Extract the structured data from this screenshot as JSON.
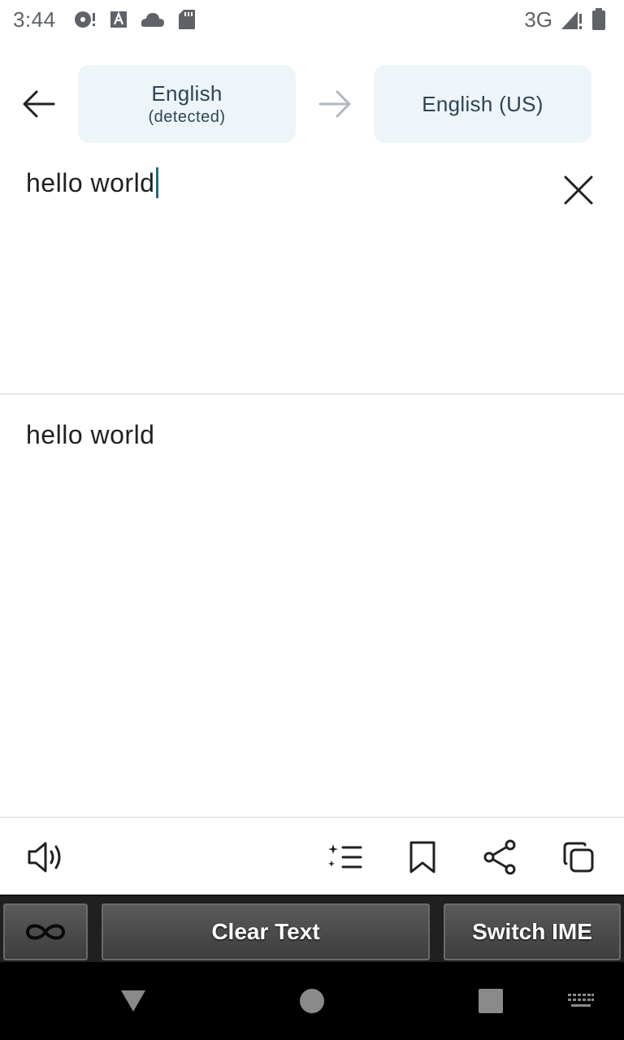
{
  "status_bar": {
    "time": "3:44",
    "network": "3G",
    "icons": [
      "sync-icon",
      "font-a-icon",
      "cloud-icon",
      "sd-card-icon",
      "signal-icon",
      "battery-icon"
    ]
  },
  "header": {
    "source_language": "English",
    "source_language_note": "(detected)",
    "target_language": "English (US)",
    "icons": [
      "back-arrow-icon",
      "direction-arrow-icon"
    ]
  },
  "input": {
    "text": "hello world"
  },
  "output": {
    "text": "hello world"
  },
  "actions": {
    "icons": [
      "speaker-icon",
      "alternatives-icon",
      "bookmark-icon",
      "share-icon",
      "copy-icon"
    ]
  },
  "ime_bar": {
    "clear_label": "Clear Text",
    "switch_label": "Switch IME"
  },
  "colors": {
    "accent": "#1a6b8f",
    "language_chip_bg": "#eef5f8",
    "language_chip_text": "#2d4458"
  }
}
